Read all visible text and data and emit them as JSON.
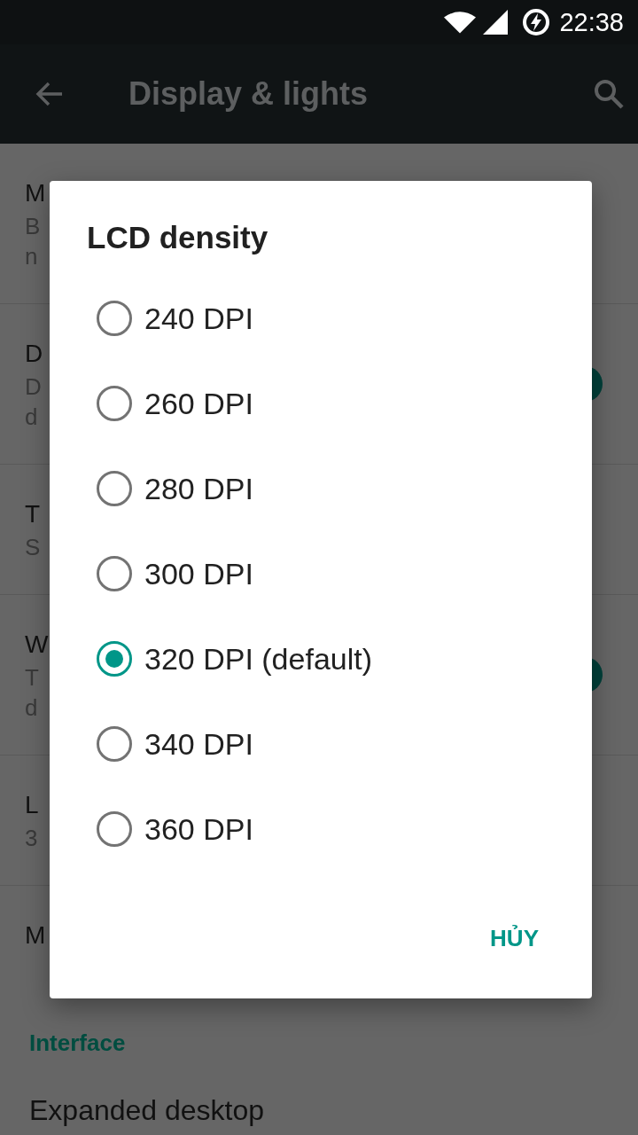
{
  "status_bar": {
    "time": "22:38"
  },
  "toolbar": {
    "title": "Display & lights"
  },
  "settings": [
    {
      "title": "M",
      "summary": [
        "B",
        "n"
      ]
    },
    {
      "title": "D",
      "summary": [
        "D",
        "d"
      ],
      "toggle": {
        "on": true
      }
    },
    {
      "title": "T",
      "summary": [
        "S"
      ]
    },
    {
      "title": "W",
      "summary": [
        "T",
        "d"
      ],
      "toggle": {
        "on": true
      }
    },
    {
      "title": "L",
      "summary": [
        "3"
      ]
    },
    {
      "title": "M"
    }
  ],
  "section": {
    "header": "Interface",
    "items": [
      {
        "title": "Expanded desktop"
      }
    ]
  },
  "dialog": {
    "title": "LCD density",
    "options": [
      {
        "label": "240 DPI",
        "selected": false
      },
      {
        "label": "260 DPI",
        "selected": false
      },
      {
        "label": "280 DPI",
        "selected": false
      },
      {
        "label": "300 DPI",
        "selected": false
      },
      {
        "label": "320 DPI (default)",
        "selected": true
      },
      {
        "label": "340 DPI",
        "selected": false
      },
      {
        "label": "360 DPI",
        "selected": false
      }
    ],
    "button": "HỦY"
  }
}
